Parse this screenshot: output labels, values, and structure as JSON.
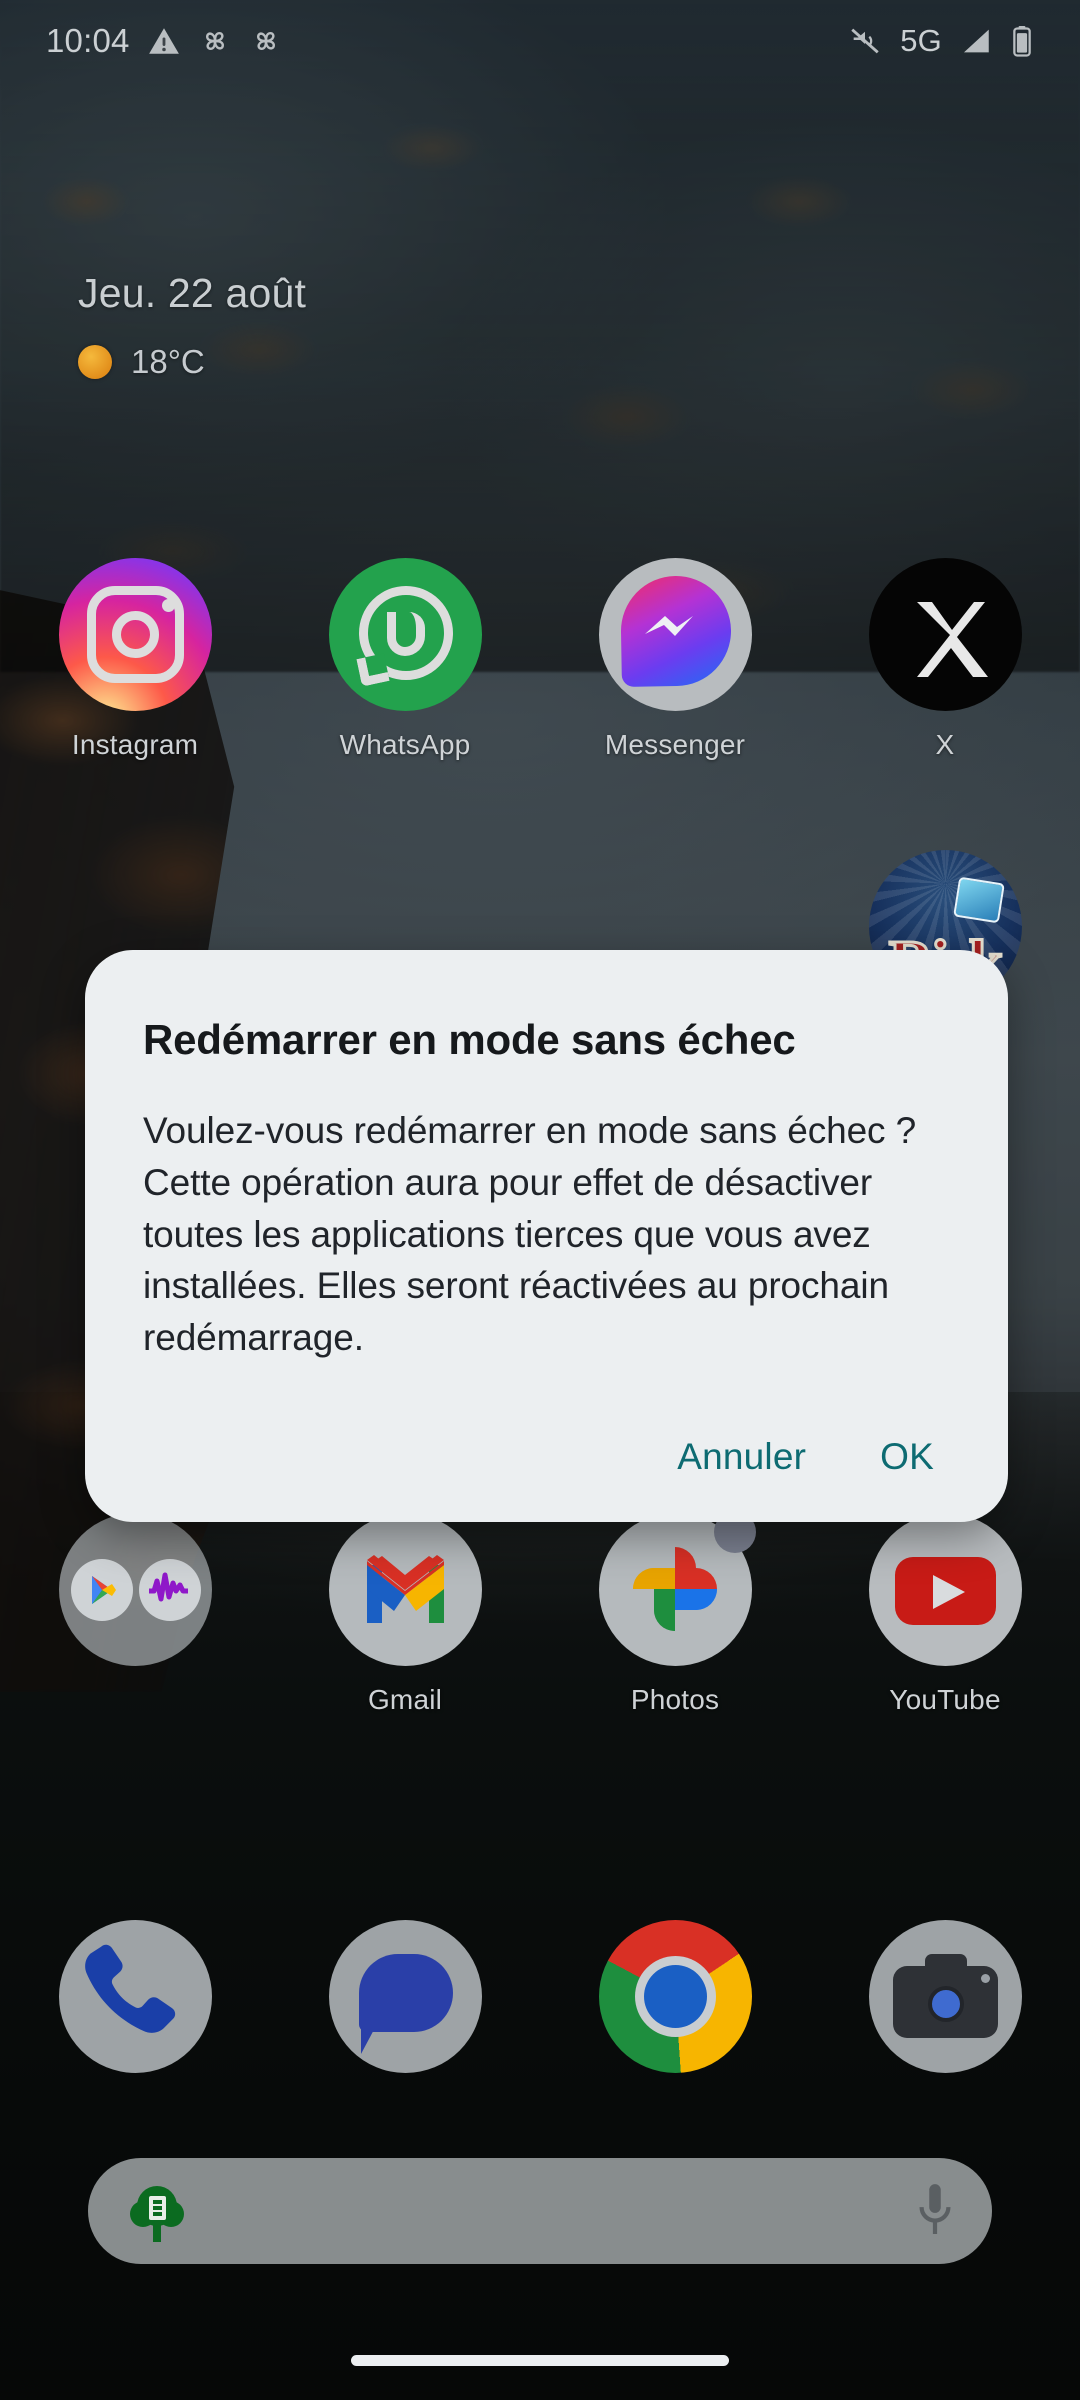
{
  "status_bar": {
    "time": "10:04",
    "left_icons": [
      "warning-triangle-icon",
      "pinwheel-icon",
      "pinwheel-icon"
    ],
    "network_label": "5G",
    "right_icons": [
      "mute-vibrate-off-icon",
      "signal-bars-icon",
      "battery-icon"
    ]
  },
  "glance_widget": {
    "date": "Jeu. 22 août",
    "temperature": "18°C",
    "weather_icon": "sunny-icon"
  },
  "home_screen": {
    "row1": [
      {
        "label": "Instagram",
        "icon": "instagram-icon"
      },
      {
        "label": "WhatsApp",
        "icon": "whatsapp-icon"
      },
      {
        "label": "Messenger",
        "icon": "messenger-icon"
      },
      {
        "label": "X",
        "icon": "x-twitter-icon"
      }
    ],
    "row2": [
      {
        "label": "",
        "icon": ""
      },
      {
        "label": "",
        "icon": ""
      },
      {
        "label": "",
        "icon": ""
      },
      {
        "label": "Risk",
        "icon": "risk-game-icon"
      }
    ],
    "row3": [
      {
        "label": "",
        "icon": "app-folder-icon"
      },
      {
        "label": "Gmail",
        "icon": "gmail-icon"
      },
      {
        "label": "Photos",
        "icon": "google-photos-icon"
      },
      {
        "label": "YouTube",
        "icon": "youtube-icon"
      }
    ],
    "dock": [
      {
        "label": "Phone",
        "icon": "phone-icon"
      },
      {
        "label": "Messages",
        "icon": "messages-icon"
      },
      {
        "label": "Chrome",
        "icon": "chrome-icon"
      },
      {
        "label": "Camera",
        "icon": "camera-icon"
      }
    ]
  },
  "search": {
    "value": "",
    "placeholder": "",
    "left_icon": "ecosia-logo-icon",
    "right_icon": "microphone-icon"
  },
  "dialog": {
    "title": "Redémarrer en mode sans échec",
    "message": "Voulez-vous redémarrer en mode sans échec ? Cette opération aura pour effet de désactiver toutes les applications tierces que vous avez installées. Elles seront réactivées au prochain redémarrage.",
    "cancel_label": "Annuler",
    "ok_label": "OK"
  },
  "colors": {
    "dialog_background": "#eceff1",
    "dialog_accent": "#0d6b72",
    "dialog_title_text": "#16191c",
    "status_text": "#c8cdd0"
  }
}
